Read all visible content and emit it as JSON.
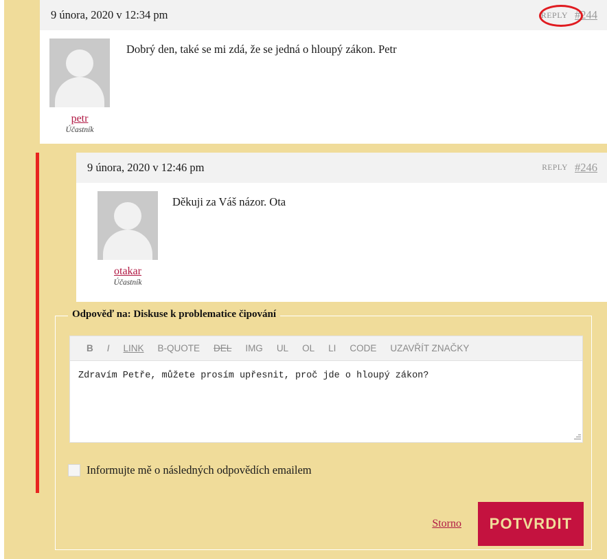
{
  "colors": {
    "page_background": "#f0dc9a",
    "comment_background": "#ffffff",
    "comment_header": "#f2f2f2",
    "accent_link": "#b01843",
    "submit_button": "#c4123f",
    "submit_button_text": "#f0dc9a",
    "thread_bar": "#e8241f",
    "annotation_ellipse": "#e01b20"
  },
  "comments": [
    {
      "date": "9 února, 2020 v 12:34 pm",
      "reply_label": "REPLY",
      "permalink": "#244",
      "author": "petr",
      "role": "Účastník",
      "text": "Dobrý den, také se mi zdá, že se jedná o hloupý zákon. Petr",
      "avatar_icon": "default-user-avatar"
    },
    {
      "date": "9 února, 2020 v 12:46 pm",
      "reply_label": "REPLY",
      "permalink": "#246",
      "author": "otakar",
      "role": "Účastník",
      "text": "Děkuji za Váš názor. Ota",
      "avatar_icon": "default-user-avatar"
    }
  ],
  "reply_form": {
    "legend": "Odpověď na: Diskuse k problematice čipování",
    "toolbar": [
      {
        "label": "B",
        "name": "bold"
      },
      {
        "label": "I",
        "name": "italic"
      },
      {
        "label": "LINK",
        "name": "link"
      },
      {
        "label": "B-QUOTE",
        "name": "blockquote"
      },
      {
        "label": "DEL",
        "name": "del"
      },
      {
        "label": "IMG",
        "name": "img"
      },
      {
        "label": "UL",
        "name": "ul"
      },
      {
        "label": "OL",
        "name": "ol"
      },
      {
        "label": "LI",
        "name": "li"
      },
      {
        "label": "CODE",
        "name": "code"
      },
      {
        "label": "UZAVŘÍT ZNAČKY",
        "name": "close-tags"
      }
    ],
    "textarea_value": "Zdravím Petře, můžete prosím upřesnit, proč jde o hloupý zákon?",
    "textarea_placeholder": "",
    "subscribe_label": "Informujte mě o následných odpovědích emailem",
    "subscribe_checked": false,
    "cancel_label": "Storno",
    "submit_label": "POTVRDIT"
  }
}
